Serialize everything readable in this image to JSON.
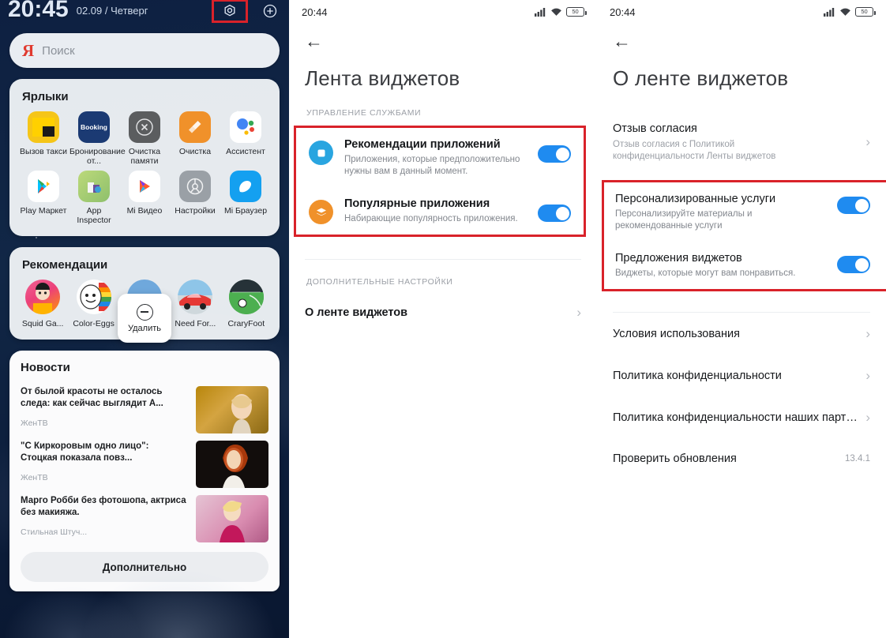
{
  "left_panel": {
    "clock": "20:45",
    "date": "02.09 / Четверг",
    "gear_icon": "gear-icon",
    "plus_icon": "plus-icon",
    "search": {
      "logo": "Я",
      "placeholder": "Поиск"
    },
    "shortcuts": {
      "title": "Ярлыки",
      "apps": [
        {
          "label": "Вызов такси",
          "icon": "taxi-icon",
          "color": "#f5c518"
        },
        {
          "label": "Бронирование от...",
          "icon": "booking-icon",
          "color": "#1b3a73"
        },
        {
          "label": "Очистка памяти",
          "icon": "memory-clean-icon",
          "color": "#5b5d5f"
        },
        {
          "label": "Очистка",
          "icon": "clean-brush-icon",
          "color": "#f0912a"
        },
        {
          "label": "Ассистент",
          "icon": "assistant-icon",
          "color": "#ffffff"
        },
        {
          "label": "Play Маркет",
          "icon": "play-store-icon",
          "color": "#ffffff"
        },
        {
          "label": "App Inspector",
          "icon": "app-inspector-icon",
          "color": "#8ec06c"
        },
        {
          "label": "Mi Видео",
          "icon": "mi-video-icon",
          "color": "#ffffff"
        },
        {
          "label": "Настройки",
          "icon": "settings-gear-icon",
          "color": "#9aa0a6"
        },
        {
          "label": "Mi Браузер",
          "icon": "mi-browser-icon",
          "color": "#14a0f0"
        }
      ]
    },
    "recommendations": {
      "title": "Рекомендации",
      "items": [
        {
          "label": "Squid Ga...",
          "icon": "squid-game-icon"
        },
        {
          "label": "Color-Eggs",
          "icon": "color-eggs-icon"
        },
        {
          "label": "",
          "icon": "racing-game-icon"
        },
        {
          "label": "Need For...",
          "icon": "need-for-speed-icon"
        },
        {
          "label": "CraryFoot",
          "icon": "crary-foot-icon"
        }
      ],
      "delete_popup": {
        "label": "Удалить",
        "icon": "minus-circle-icon"
      }
    },
    "news": {
      "title": "Новости",
      "items": [
        {
          "headline": "От былой красоты не осталось следа: как сейчас выглядит А...",
          "source": "ЖенТВ",
          "thumb": "news-thumb-1"
        },
        {
          "headline": "\"С Киркоровым одно лицо\": Стоцкая показала повз...",
          "source": "ЖенТВ",
          "thumb": "news-thumb-2"
        },
        {
          "headline": "Марго Робби без фотошопа, актриса без макияжа.",
          "source": "Стильная Штуч...",
          "thumb": "news-thumb-3"
        }
      ],
      "more_button": "Дополнительно"
    }
  },
  "mid_panel": {
    "statusbar": {
      "time": "20:44",
      "battery": "50",
      "signal_icon": "signal-icon",
      "wifi_icon": "wifi-icon"
    },
    "back_icon": "back-arrow-icon",
    "title": "Лента виджетов",
    "section_label": "УПРАВЛЕНИЕ СЛУЖБАМИ",
    "settings": [
      {
        "title": "Рекомендации приложений",
        "desc": "Приложения, которые предположительно нужны вам в данный момент.",
        "icon": "app-recommendation-icon",
        "icon_color": "#29a5e0",
        "toggle": "on"
      },
      {
        "title": "Популярные приложения",
        "desc": "Набирающие популярность приложения.",
        "icon": "popular-apps-layers-icon",
        "icon_color": "#f0912a",
        "toggle": "on"
      }
    ],
    "extra_label": "ДОПОЛНИТЕЛЬНЫЕ НАСТРОЙКИ",
    "about_row": {
      "title": "О ленте виджетов",
      "chevron": "chevron-right-icon"
    }
  },
  "right_panel": {
    "statusbar": {
      "time": "20:44",
      "battery": "50",
      "signal_icon": "signal-icon",
      "wifi_icon": "wifi-icon"
    },
    "back_icon": "back-arrow-icon",
    "title": "О ленте виджетов",
    "consent": {
      "title": "Отзыв согласия",
      "desc": "Отзыв согласия с Политикой конфиденциальности Ленты виджетов",
      "chevron": "chevron-right-icon"
    },
    "toggles": [
      {
        "title": "Персонализированные услуги",
        "desc": "Персонализируйте материалы и рекомендованные услуги",
        "toggle": "on"
      },
      {
        "title": "Предложения виджетов",
        "desc": "Виджеты, которые могут вам понравиться.",
        "toggle": "on"
      }
    ],
    "links": [
      {
        "title": "Условия использования",
        "chevron": "chevron-right-icon",
        "value": ""
      },
      {
        "title": "Политика конфиденциальности",
        "chevron": "chevron-right-icon",
        "value": ""
      },
      {
        "title": "Политика конфиденциальности наших партн…",
        "chevron": "chevron-right-icon",
        "value": ""
      },
      {
        "title": "Проверить обновления",
        "chevron": "",
        "value": "13.4.1"
      }
    ]
  },
  "colors": {
    "highlight": "#d9222a",
    "toggle_on": "#1f8bf0",
    "accent_blue": "#29a5e0",
    "accent_orange": "#f0912a"
  }
}
